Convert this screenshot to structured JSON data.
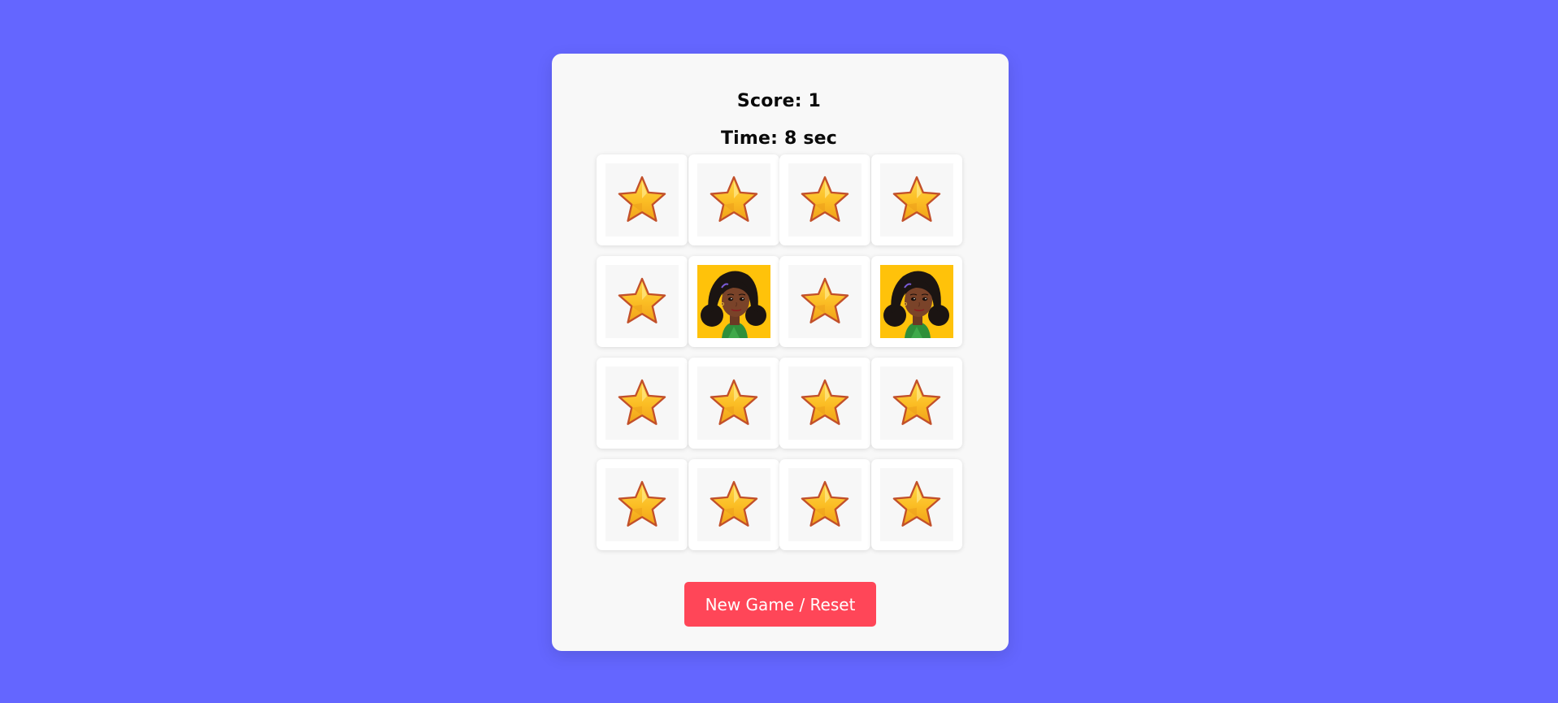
{
  "score": {
    "text": "Score: 1"
  },
  "time": {
    "text": "Time: 8 sec"
  },
  "colors": {
    "background": "#6466ff",
    "panel": "#f8f8f8",
    "reset_button": "#ff4658",
    "revealed_card": "#ffc20a"
  },
  "board": {
    "rows": 4,
    "cols": 4,
    "cards": [
      {
        "face": "star-icon",
        "revealed": false
      },
      {
        "face": "star-icon",
        "revealed": false
      },
      {
        "face": "star-icon",
        "revealed": false
      },
      {
        "face": "star-icon",
        "revealed": false
      },
      {
        "face": "star-icon",
        "revealed": false
      },
      {
        "face": "girl-portrait",
        "revealed": true
      },
      {
        "face": "star-icon",
        "revealed": false
      },
      {
        "face": "girl-portrait",
        "revealed": true
      },
      {
        "face": "star-icon",
        "revealed": false
      },
      {
        "face": "star-icon",
        "revealed": false
      },
      {
        "face": "star-icon",
        "revealed": false
      },
      {
        "face": "star-icon",
        "revealed": false
      },
      {
        "face": "star-icon",
        "revealed": false
      },
      {
        "face": "star-icon",
        "revealed": false
      },
      {
        "face": "star-icon",
        "revealed": false
      },
      {
        "face": "star-icon",
        "revealed": false
      }
    ]
  },
  "reset_button": {
    "label": "New Game / Reset"
  }
}
